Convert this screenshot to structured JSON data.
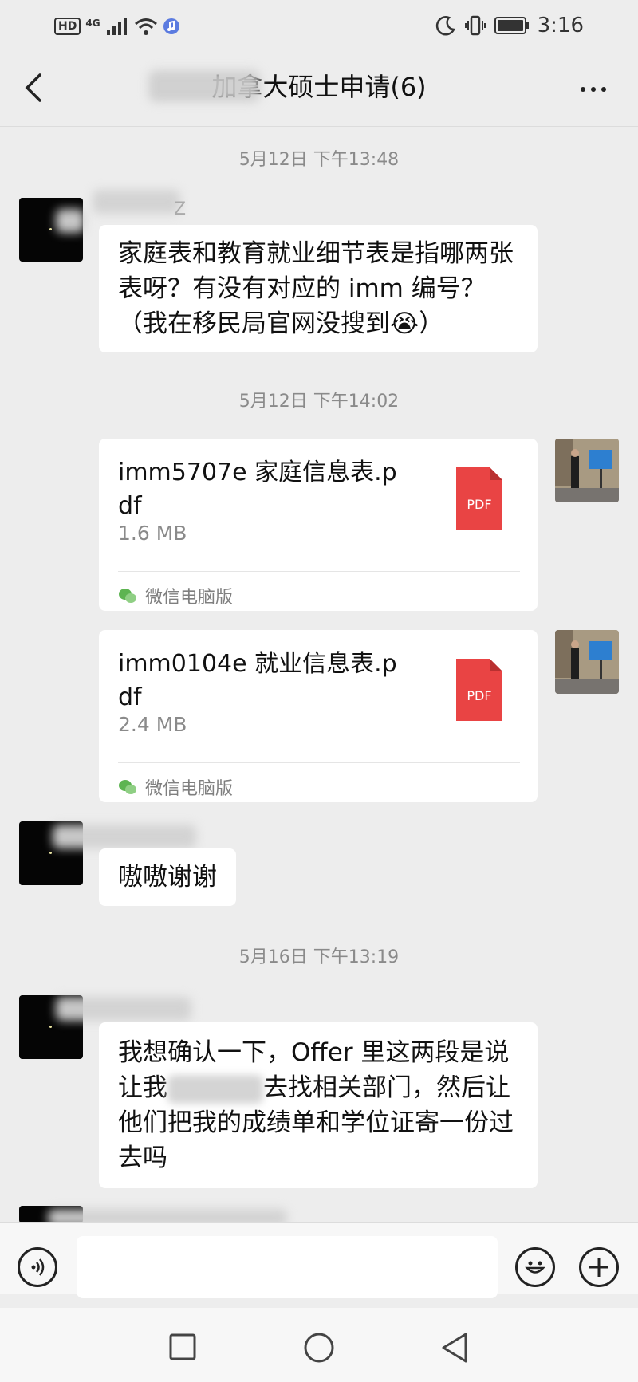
{
  "status_bar": {
    "hd": "HD",
    "network": "4G",
    "time": "3:16"
  },
  "header": {
    "title": "加拿大硕士申请(6)",
    "back_icon": "chevron-left-icon",
    "more_icon": "more-dots-icon"
  },
  "messages": {
    "ts1": "5月12日 下午13:48",
    "msg1": "家庭表和教育就业细节表是指哪两张表呀？有没有对应的 imm 编号？（我在移民局官网没搜到😭）",
    "ts2": "5月12日 下午14:02",
    "file1": {
      "name": "imm5707e 家庭信息表.pdf",
      "size": "1.6 MB",
      "badge": "PDF",
      "source": "微信电脑版"
    },
    "file2": {
      "name": "imm0104e 就业信息表.pdf",
      "size": "2.4 MB",
      "badge": "PDF",
      "source": "微信电脑版"
    },
    "msg2": "嗷嗷谢谢",
    "ts3": "5月16日 下午13:19",
    "msg3_part1": "我想确认一下，Offer 里这两段是说让我",
    "msg3_part2": "去找相关部门，然后让他们把我的成绩单和学位证寄一份过去吗"
  },
  "input_bar": {
    "placeholder": "",
    "voice_icon": "voice-icon",
    "emoji_icon": "emoji-icon",
    "plus_icon": "plus-icon"
  },
  "nav": {
    "recent_icon": "square-icon",
    "home_icon": "circle-icon",
    "back_icon": "triangle-back-icon"
  },
  "colors": {
    "background": "#ededed",
    "bubble": "#ffffff",
    "pdf_red": "#e94444",
    "timestamp": "#8a8a8a",
    "wechat_green": "#5db451"
  }
}
